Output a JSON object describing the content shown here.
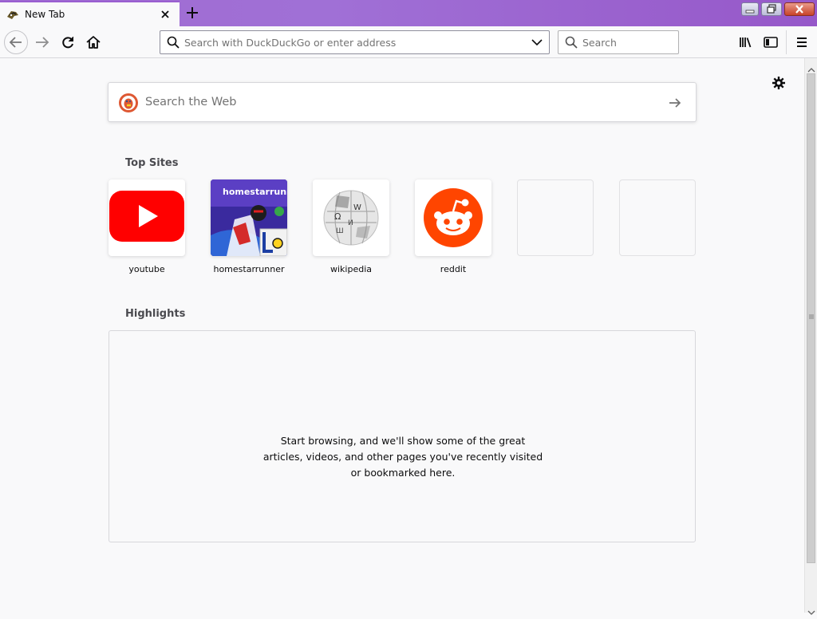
{
  "browser": {
    "tab": {
      "title": "New Tab"
    },
    "urlbar": {
      "placeholder": "Search with DuckDuckGo or enter address"
    },
    "searchbar": {
      "placeholder": "Search"
    }
  },
  "newtab": {
    "web_search": {
      "placeholder": "Search the Web"
    },
    "top_sites": {
      "title": "Top Sites",
      "sites": [
        {
          "label": "youtube"
        },
        {
          "label": "homestarrunner",
          "banner_text": "homestarrunner"
        },
        {
          "label": "wikipedia",
          "logo_glyphs": [
            "Ω",
            "W",
            "И",
            "Ш"
          ]
        },
        {
          "label": "reddit"
        },
        {
          "label": ""
        },
        {
          "label": ""
        }
      ]
    },
    "highlights": {
      "title": "Highlights",
      "message": "Start browsing, and we'll show some of the great articles, videos, and other pages you've recently visited or bookmarked here."
    }
  },
  "colors": {
    "tabstrip": "#9f6bd1",
    "youtube": "#ff0000",
    "reddit": "#ff4500"
  }
}
